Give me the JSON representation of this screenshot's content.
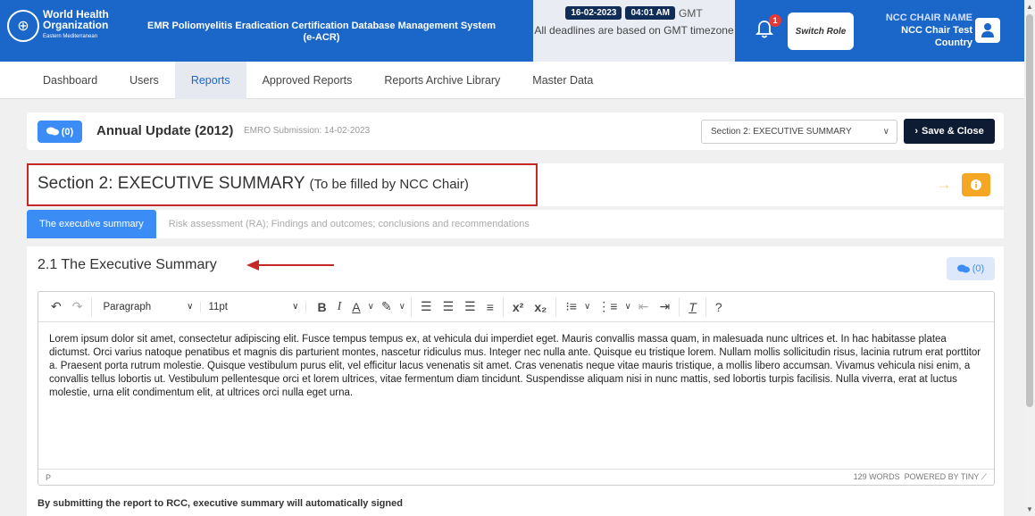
{
  "header": {
    "org_line1": "World Health",
    "org_line2": "Organization",
    "org_region": "Eastern Mediterranean",
    "app_title": "EMR Poliomyelitis Eradication Certification Database Management System (e-ACR)",
    "date": "16-02-2023",
    "time": "04:01 AM",
    "timezone": "GMT",
    "deadline_note": "All deadlines are based on GMT timezone",
    "notification_count": "1",
    "switch_role_label": "Switch Role",
    "user_role": "NCC CHAIR NAME",
    "user_name": "NCC Chair Test",
    "user_country": "Country"
  },
  "nav": {
    "items": [
      "Dashboard",
      "Users",
      "Reports",
      "Approved Reports",
      "Reports Archive Library",
      "Master Data"
    ],
    "active": "Reports"
  },
  "report_bar": {
    "comment_count": "(0)",
    "title": "Annual Update (2012)",
    "submission": "EMRO Submission: 14-02-2023",
    "section_select": "Section 2: EXECUTIVE SUMMARY",
    "save_close_label": "Save & Close"
  },
  "section": {
    "title": "Section 2: EXECUTIVE SUMMARY",
    "subtitle": "(To be filled by NCC Chair)"
  },
  "tabs": [
    "The executive summary",
    "Risk assessment (RA); Findings and outcomes; conclusions and recommendations"
  ],
  "content": {
    "heading_num": "2.1",
    "heading": "The Executive Summary",
    "comment_count": "(0)",
    "toolbar": {
      "block_format": "Paragraph",
      "font_size": "11pt"
    },
    "body_text": "Lorem ipsum dolor sit amet, consectetur adipiscing elit. Fusce tempus tempus ex, at vehicula dui imperdiet eget. Mauris convallis massa quam, in malesuada nunc ultrices et. In hac habitasse platea dictumst. Orci varius natoque penatibus et magnis dis parturient montes, nascetur ridiculus mus. Integer nec nulla ante. Quisque eu tristique lorem. Nullam mollis sollicitudin risus, lacinia rutrum erat porttitor a. Praesent porta rutrum molestie. Quisque vestibulum purus elit, vel efficitur lacus venenatis sit amet. Cras venenatis neque vitae mauris tristique, a mollis libero accumsan. Vivamus vehicula nisi enim, a convallis tellus lobortis ut. Vestibulum pellentesque orci et lorem ultrices, vitae fermentum diam tincidunt. Suspendisse aliquam nisi in nunc mattis, sed lobortis turpis facilisis. Nulla viverra, erat at luctus molestie, urna elit condimentum elit, at ultrices orci nulla eget urna.",
    "status_path": "P",
    "word_count": "129 WORDS",
    "powered_by": "POWERED BY TINY",
    "footer_note": "By submitting the report to RCC, executive summary will automatically signed"
  },
  "colors": {
    "brand_blue": "#1b66c9",
    "accent_blue": "#3b8df5",
    "dark_navy": "#0d1b33",
    "highlight_red": "#c62828",
    "warning_orange": "#f5a623"
  }
}
